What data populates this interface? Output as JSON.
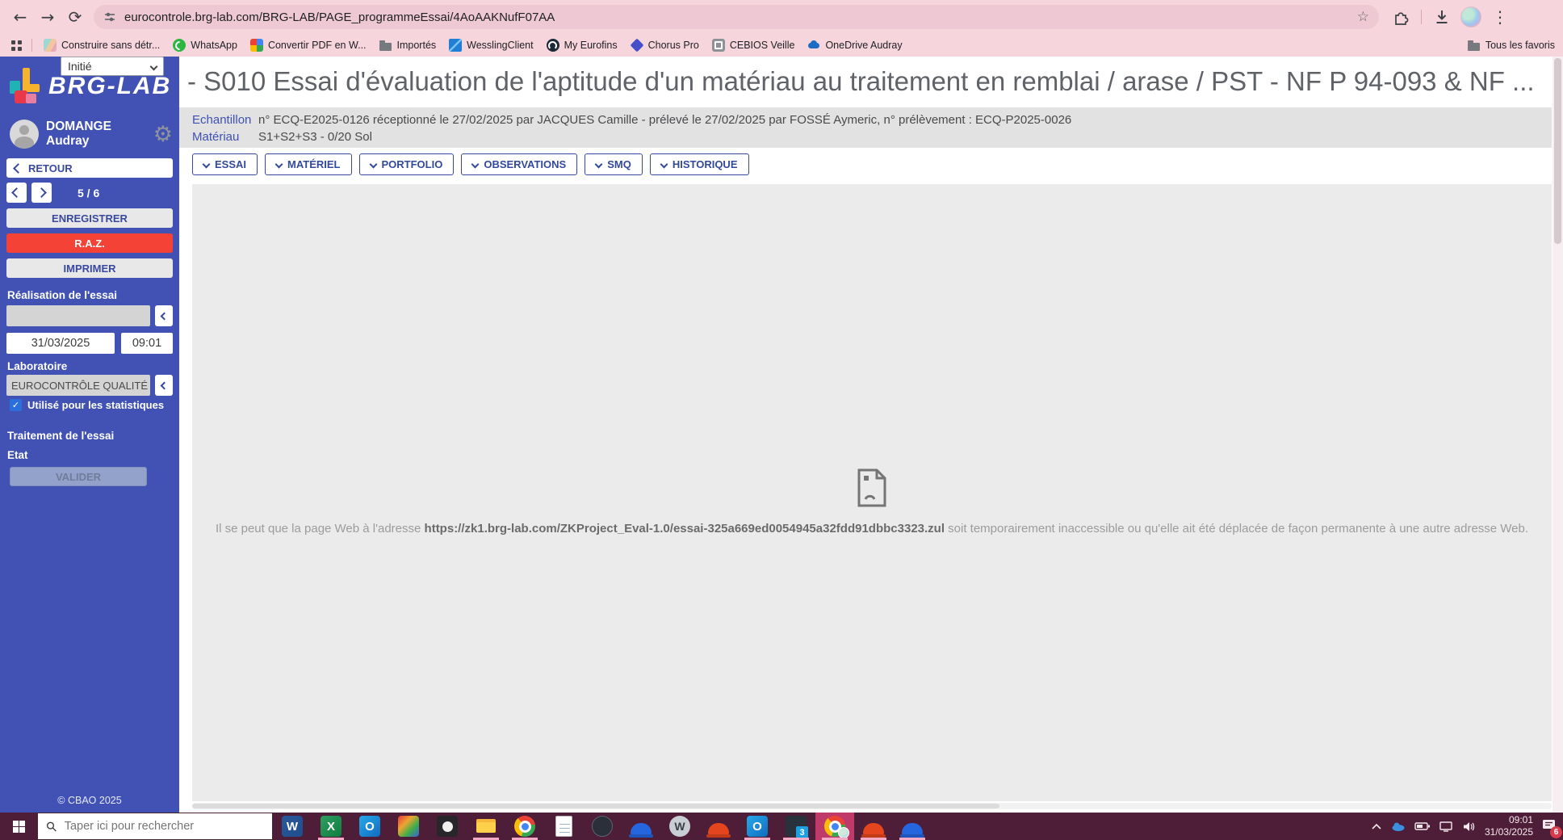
{
  "browser": {
    "url": "eurocontrole.brg-lab.com/BRG-LAB/PAGE_programmeEssai/4AoAAKNufF07AA",
    "bookmarks": [
      {
        "label": "Construire sans détr..."
      },
      {
        "label": "WhatsApp"
      },
      {
        "label": "Convertir PDF en W..."
      },
      {
        "label": "Importés"
      },
      {
        "label": "WesslingClient"
      },
      {
        "label": "My Eurofins"
      },
      {
        "label": "Chorus Pro"
      },
      {
        "label": "CEBIOS Veille"
      },
      {
        "label": "OneDrive Audray"
      }
    ],
    "all_favorites_label": "Tous les favoris"
  },
  "icons": {
    "back": "←",
    "forward": "→",
    "refresh": "⟳",
    "star": "☆",
    "menu": "⋮",
    "gear": "⚙",
    "check": "✓"
  },
  "sidebar": {
    "logo_text": "BRG-LAB",
    "user_name": "DOMANGE Audray",
    "back_label": "RETOUR",
    "pager": "5 / 6",
    "save_label": "ENREGISTRER",
    "reset_label": "R.A.Z.",
    "print_label": "IMPRIMER",
    "realisation_label": "Réalisation de l'essai",
    "realisation_value": "",
    "date_value": "31/03/2025",
    "time_value": "09:01",
    "laboratoire_label": "Laboratoire",
    "laboratoire_value": "EUROCONTRÔLE QUALITÉ",
    "stats_checkbox_label": "Utilisé pour les statistiques",
    "traitement_label": "Traitement de l'essai",
    "etat_label": "Etat",
    "etat_value": "Initié",
    "valider_label": "VALIDER",
    "copyright": "© CBAO 2025"
  },
  "main": {
    "title": "- S010 Essai d'évaluation de l'aptitude d'un matériau au traitement en remblai / arase / PST - NF P 94-093 & NF ...",
    "echantillon_label": "Echantillon",
    "echantillon_value": "n° ECQ-E2025-0126 réceptionné le 27/02/2025 par JACQUES Camille - prélevé le 27/02/2025 par FOSSÉ Aymeric, n° prélèvement : ECQ-P2025-0026",
    "materiau_label": "Matériau",
    "materiau_value": "S1+S2+S3 - 0/20 Sol",
    "tabs": [
      {
        "label": "ESSAI"
      },
      {
        "label": "MATÉRIEL"
      },
      {
        "label": "PORTFOLIO"
      },
      {
        "label": "OBSERVATIONS"
      },
      {
        "label": "SMQ"
      },
      {
        "label": "HISTORIQUE"
      }
    ],
    "error": {
      "prefix": "Il se peut que la page Web à l'adresse ",
      "url": "https://zk1.brg-lab.com/ZKProject_Eval-1.0/essai-325a669ed0054945a32fdd91dbbc3323.zul",
      "suffix": " soit temporairement inaccessible ou qu'elle ait été déplacée de façon permanente à une autre adresse Web."
    }
  },
  "taskbar": {
    "search_placeholder": "Taper ici pour rechercher",
    "apps": [
      {
        "name": "word",
        "letter": "W"
      },
      {
        "name": "excel",
        "letter": "X"
      },
      {
        "name": "outlook",
        "letter": "O"
      },
      {
        "name": "photos",
        "letter": ""
      },
      {
        "name": "panda-app",
        "letter": ""
      },
      {
        "name": "file-explorer",
        "letter": ""
      },
      {
        "name": "chrome",
        "letter": ""
      },
      {
        "name": "notepad",
        "letter": ""
      },
      {
        "name": "dark-app",
        "letter": ""
      },
      {
        "name": "helmet-blue-app",
        "letter": ""
      },
      {
        "name": "w-app",
        "letter": "W"
      },
      {
        "name": "helmet-red-app",
        "letter": ""
      },
      {
        "name": "outlook-2",
        "letter": "O"
      },
      {
        "name": "3cx",
        "letter": "3"
      },
      {
        "name": "chrome-active",
        "letter": ""
      },
      {
        "name": "helmet-red-app-2",
        "letter": ""
      },
      {
        "name": "helmet-blue-app-2",
        "letter": ""
      }
    ],
    "tray": {
      "time": "09:01",
      "date": "31/03/2025",
      "notification_count": "6"
    }
  },
  "colors": {
    "sidebar_blue": "#4152b4",
    "accent_blue_text": "#3949a0",
    "reset_red": "#f44336",
    "chrome_theme_pink": "#f7d5dd",
    "taskbar_maroon": "#4e1d37",
    "iframe_gray": "#ebebeb"
  }
}
